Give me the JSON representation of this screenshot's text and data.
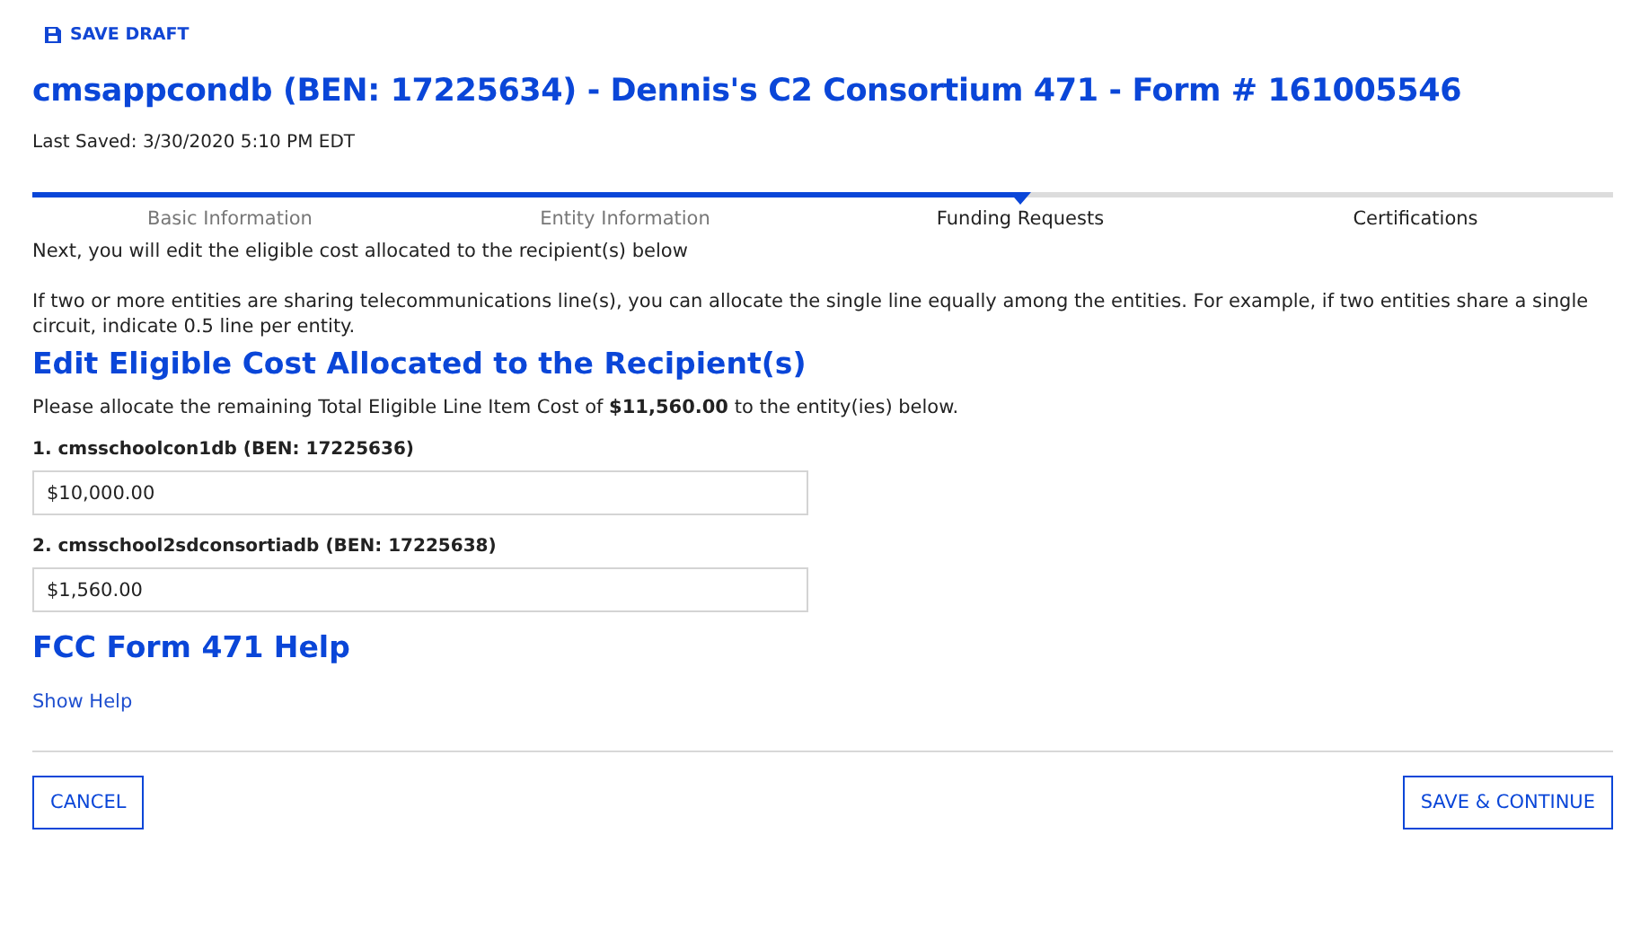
{
  "toolbar": {
    "save_draft": "SAVE DRAFT"
  },
  "title": "cmsappcondb (BEN: 17225634) - Dennis's C2 Consortium 471 - Form # 161005546",
  "last_saved": "Last Saved: 3/30/2020 5:10 PM EDT",
  "steps": [
    {
      "label": "Basic Information",
      "completed": true,
      "selected": false
    },
    {
      "label": "Entity Information",
      "completed": true,
      "selected": false
    },
    {
      "label": "Funding Requests",
      "completed": false,
      "selected": true
    },
    {
      "label": "Certifications",
      "completed": false,
      "selected": false
    }
  ],
  "intro": "Next, you will edit the eligible cost allocated to the recipient(s) below",
  "note": "If two or more entities are sharing telecommunications line(s), you can allocate the single line equally among the entities. For example, if two entities share a single circuit, indicate 0.5 line per entity.",
  "section_heading": "Edit Eligible Cost Allocated to the Recipient(s)",
  "instruction": "Please allocate the remaining Total Eligible Line Item Cost of **$11,560.00** to the entity(ies) below.",
  "entities": [
    {
      "label": "1. cmsschoolcon1db (BEN: 17225636)",
      "value": "$10,000.00"
    },
    {
      "label": "2. cmsschool2sdconsortiadb (BEN: 17225638)",
      "value": "$1,560.00"
    }
  ],
  "help": {
    "heading": "FCC Form 471 Help",
    "link": "Show Help"
  },
  "buttons": {
    "cancel": "CANCEL",
    "save_continue": "SAVE & CONTINUE"
  }
}
